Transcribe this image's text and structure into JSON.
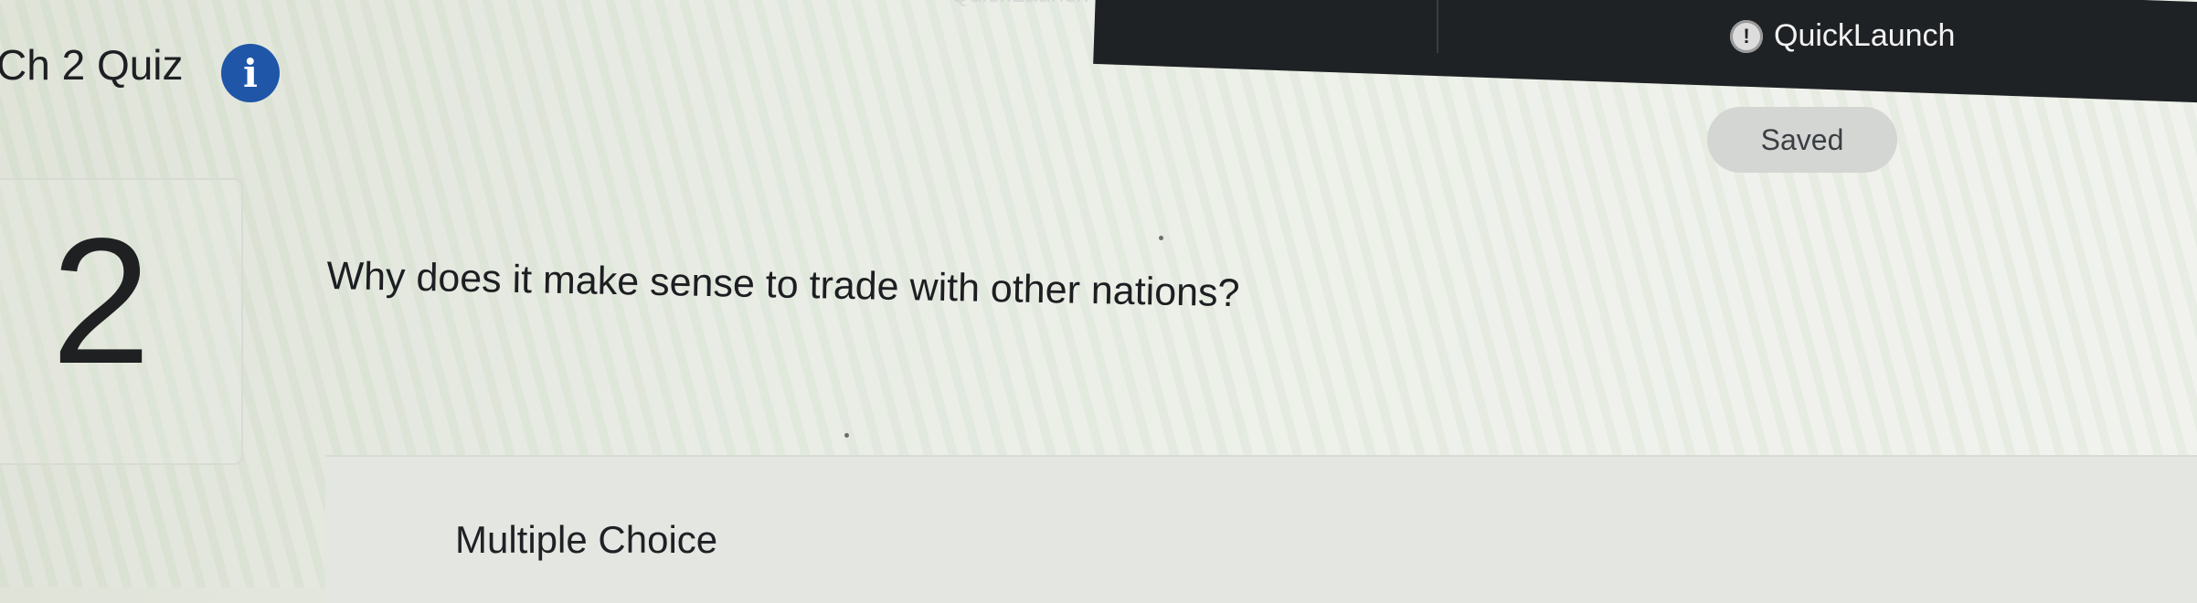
{
  "header": {
    "quiz_title": "Ch 2 Quiz",
    "info_icon": "info-icon",
    "quicklaunch_label": "QuickLaunch",
    "quicklaunch_icon": "quicklaunch-icon",
    "quicklaunch_ghost_label": "QuickLaunch",
    "saved_status": "Saved"
  },
  "question": {
    "number": "2",
    "prompt": "Why does it make sense to trade with other nations?",
    "type_label": "Multiple Choice"
  },
  "colors": {
    "info_icon_blue": "#1f56a8",
    "topbar_dark": "#1f2224",
    "saved_pill": "#d3d6d3"
  }
}
